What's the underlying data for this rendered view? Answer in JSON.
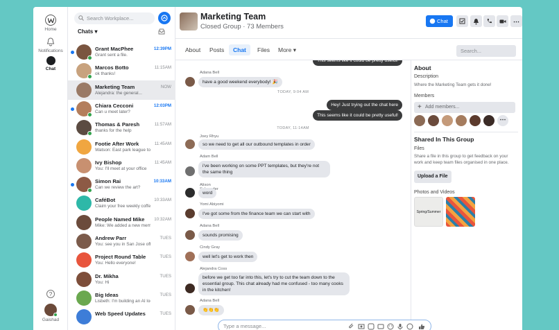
{
  "rail": {
    "home": "Home",
    "notifications": "Notifications",
    "chat": "Chat",
    "help": "?",
    "user": "Gaishad"
  },
  "list": {
    "search_placeholder": "Search Workplace...",
    "heading": "Chats",
    "chats": [
      {
        "name": "Grant MacPhee",
        "preview": "Grant sent a file.",
        "time": "12:39PM",
        "unread": true,
        "online": true,
        "avatar": "#7a5540"
      },
      {
        "name": "Marcos Botto",
        "preview": "ok thanks!",
        "time": "11:15AM",
        "unread": false,
        "online": true,
        "avatar": "#c8a27e"
      },
      {
        "name": "Marketing Team",
        "preview": "Alejandra: the general...",
        "time": "NOW",
        "unread": false,
        "online": false,
        "avatar": "#9a7a66",
        "selected": true
      },
      {
        "name": "Chiara Cecconi",
        "preview": "Can u meet later?",
        "time": "12:03PM",
        "unread": true,
        "online": true,
        "avatar": "#b47e5c"
      },
      {
        "name": "Thomas & Paresh",
        "preview": "thanks for the help",
        "time": "11:57AM",
        "unread": false,
        "online": true,
        "avatar": "#5b4b42"
      },
      {
        "name": "Footie After Work",
        "preview": "Watson: East park league tonight...",
        "time": "11:45AM",
        "unread": false,
        "online": false,
        "avatar": "#f0a640"
      },
      {
        "name": "Ivy Bishop",
        "preview": "You: I'll meet at your office",
        "time": "11:45AM",
        "unread": false,
        "online": false,
        "avatar": "#c89070"
      },
      {
        "name": "Simon Rai",
        "preview": "Can we review the art?",
        "time": "10:33AM",
        "unread": true,
        "online": true,
        "avatar": "#8d5a45"
      },
      {
        "name": "CaféBot",
        "preview": "Claim your free weekly coffee!",
        "time": "10:33AM",
        "unread": false,
        "online": false,
        "avatar": "#2eb8a8"
      },
      {
        "name": "People Named Mike",
        "preview": "Mike: We added a new member...",
        "time": "10:32AM",
        "unread": false,
        "online": false,
        "avatar": "#6b4b3c"
      },
      {
        "name": "Andrew Parr",
        "preview": "You: see you in San Jose office!",
        "time": "TUES",
        "unread": false,
        "online": false,
        "avatar": "#7b5b4b"
      },
      {
        "name": "Project Round Table",
        "preview": "You: Hello everyone!",
        "time": "TUES",
        "unread": false,
        "online": false,
        "avatar": "#e8553d"
      },
      {
        "name": "Dr. Mikha",
        "preview": "You: Hi",
        "time": "TUES",
        "unread": false,
        "online": false,
        "avatar": "#7d4e3a"
      },
      {
        "name": "Big Ideas",
        "preview": "Lisbeth: I'm building an AI loom?",
        "time": "TUES",
        "unread": false,
        "online": false,
        "avatar": "#6aa84f"
      },
      {
        "name": "Web Speed Updates",
        "preview": "",
        "time": "TUES",
        "unread": false,
        "online": false,
        "avatar": "#3d7dd8"
      }
    ]
  },
  "header": {
    "title": "Marketing Team",
    "subtitle": "Closed Group · 73 Members",
    "chat_button": "Chat"
  },
  "tabs": [
    "About",
    "Posts",
    "Chat",
    "Files",
    "More ▾"
  ],
  "group_search_placeholder": "Search...",
  "messages": {
    "top_out": "This seems like it could be pretty useful!",
    "m1_sender": "Adana Bell",
    "m1": "have a good weekend everybody! 🎉",
    "ts1": "TODAY, 9:04 AM",
    "out1": "Hey! Just trying out the chat here",
    "out2": "This seems like it could be pretty useful!",
    "ts2": "TODAY, 11:14AM",
    "m2_sender": "Joey Rhyu",
    "m2": "so we need to get all our outbound templates in order",
    "m3_sender": "Adam Bell",
    "m3": "i've been working on some PPT templates, but they're not the same thing",
    "m4_sender": "Alison Schroeder",
    "m4": "word",
    "m5_sender": "Yomi Abiyomi",
    "m5": "I've got some from the finance team we can start with",
    "m6_sender": "Adana Bell",
    "m6": "sounds promising",
    "m7_sender": "Cindy Gray",
    "m7": "well let's get to work then",
    "m8_sender": "Alejandra Coss",
    "m8": "before we get too far into this, let's try to cut the team down to the essential group. This chat already had me confused - too many cooks in the kitchen!",
    "m9_sender": "Adana Bell",
    "m9": "👏👏👏",
    "composer_placeholder": "Type a message..."
  },
  "side": {
    "about": "About",
    "description_label": "Description",
    "description": "Where the Marketing Team gets it done!",
    "members": "Members",
    "add_members": "Add members...",
    "shared": "Shared In This Group",
    "files": "Files",
    "files_text": "Share a file in this group to get feedback on your work and keep team files organised in one place.",
    "upload": "Upload a File",
    "photos": "Photos and Videos",
    "photo_text": "Spring/Summer"
  }
}
